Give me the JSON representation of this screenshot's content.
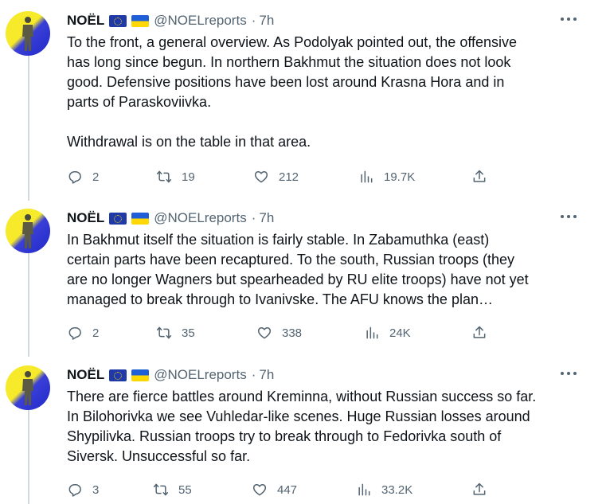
{
  "author": {
    "name": "NOËL",
    "handle": "@NOELreports",
    "time": "7h"
  },
  "tweets": [
    {
      "text": "To the front, a general overview. As Podolyak pointed out, the offensive\nhas long since begun. In northern Bakhmut the situation does not look\ngood. Defensive positions have been lost around Krasna Hora and in\nparts of Paraskoviivka.\n\nWithdrawal is on the table in that area.",
      "replies": "2",
      "retweets": "19",
      "likes": "212",
      "views": "19.7K"
    },
    {
      "text": "In Bakhmut itself the situation is fairly stable. In Zabamuthka (east)\ncertain parts have been recaptured. To the south, Russian troops (they\nare no longer Wagners but spearheaded by RU elite troops) have not yet\nmanaged to break through to Ivanivske. The AFU knows the plan…",
      "replies": "2",
      "retweets": "35",
      "likes": "338",
      "views": "24K"
    },
    {
      "text": "There are fierce battles around Kreminna, without Russian success so far.\nIn Bilohorivka we see Vuhledar-like scenes. Huge Russian losses around\nShypilivka. Russian troops try to break through to Fedorivka south of\nSiversk. Unsuccessful so far.",
      "replies": "3",
      "retweets": "55",
      "likes": "447",
      "views": "33.2K"
    }
  ],
  "icons": {
    "reply": "reply-icon",
    "retweet": "retweet-icon",
    "like": "heart-icon",
    "views": "views-icon",
    "share": "share-icon",
    "more": "more-icon",
    "flags": [
      "eu-flag-icon",
      "ukraine-flag-icon"
    ]
  },
  "colors": {
    "text": "#0f1419",
    "muted": "#536471",
    "thread_line": "#cfd9de"
  }
}
